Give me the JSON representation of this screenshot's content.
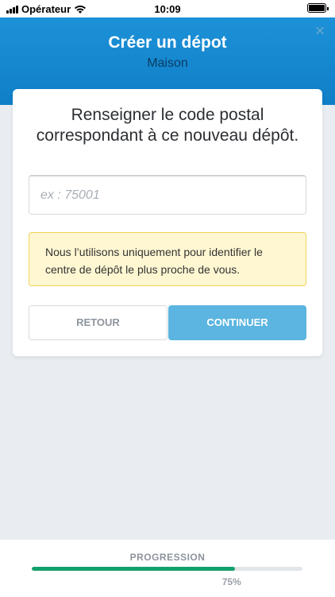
{
  "status_bar": {
    "carrier": "Opérateur",
    "time": "10:09",
    "icons": [
      "signal-icon",
      "wifi-icon",
      "battery-icon"
    ]
  },
  "header": {
    "title": "Créer un dépot",
    "subtitle": "Maison",
    "close_icon": "×"
  },
  "card": {
    "heading": "Renseigner le code postal correspondant à ce nouveau dépôt.",
    "postal_input": {
      "value": "",
      "placeholder": "ex : 75001"
    },
    "info_text": "Nous l’utilisons uniquement pour identifier le centre de dépôt le plus proche de vous.",
    "back_label": "RETOUR",
    "continue_label": "CONTINUER"
  },
  "footer": {
    "progress_label": "PROGRESSION",
    "progress_value": 75,
    "progress_text": "75%"
  },
  "colors": {
    "header": "#1d91d8",
    "accent_button": "#5bb5e0",
    "progress": "#14a06d",
    "info_background": "#fff7d2",
    "info_border": "#f0d35b"
  }
}
